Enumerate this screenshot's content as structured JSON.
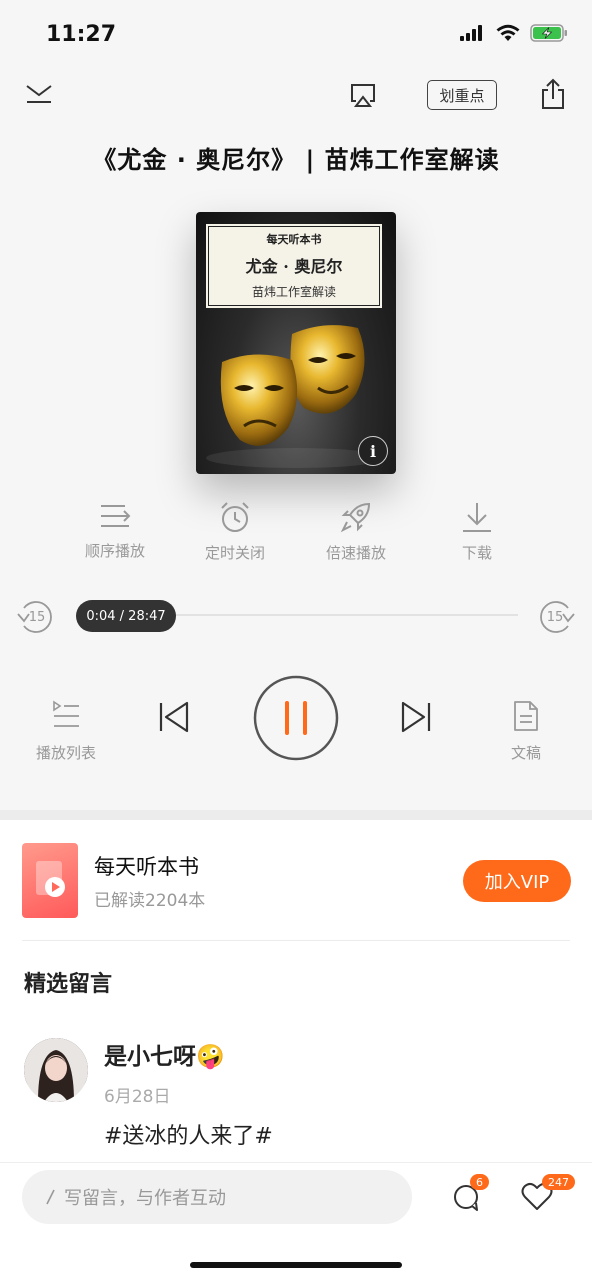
{
  "status": {
    "time": "11:27"
  },
  "header": {
    "highlight_label": "划重点"
  },
  "title": "《尤金 · 奥尼尔》 | 苗炜工作室解读",
  "cover": {
    "series": "每天听本书",
    "book": "尤金 · 奥尼尔",
    "author": "苗炜工作室解读",
    "info_glyph": "i"
  },
  "actions": [
    {
      "label": "顺序播放",
      "icon": "sequence-icon"
    },
    {
      "label": "定时关闭",
      "icon": "alarm-clock-icon"
    },
    {
      "label": "倍速播放",
      "icon": "rocket-icon"
    },
    {
      "label": "下载",
      "icon": "download-icon"
    }
  ],
  "player": {
    "rewind_seconds": "15",
    "forward_seconds": "15",
    "time_display": "0:04 / 28:47",
    "playlist_label": "播放列表",
    "transcript_label": "文稿",
    "state": "playing"
  },
  "vip": {
    "title": "每天听本书",
    "subtitle": "已解读2204本",
    "button": "加入VIP"
  },
  "comments": {
    "section_title": "精选留言",
    "items": [
      {
        "name": "是小七呀🤪",
        "date": "6月28日",
        "text": "#送冰的人来了#"
      }
    ]
  },
  "bottom": {
    "input_placeholder": "写留言，与作者互动",
    "comment_count": "6",
    "like_count": "247"
  },
  "colors": {
    "accent": "#ff6a1a",
    "background": "#f6f6f6"
  }
}
